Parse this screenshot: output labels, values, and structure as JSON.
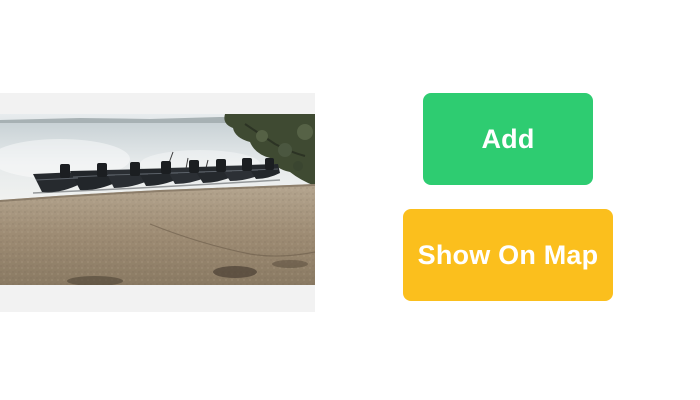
{
  "colors": {
    "add_button": "#2ecc71",
    "map_button": "#fbbf1d",
    "photo_frame": "#f2f2f2"
  },
  "photo": {
    "subject": "beach-with-moored-boats"
  },
  "buttons": {
    "add_label": "Add",
    "map_label": "Show On Map"
  }
}
